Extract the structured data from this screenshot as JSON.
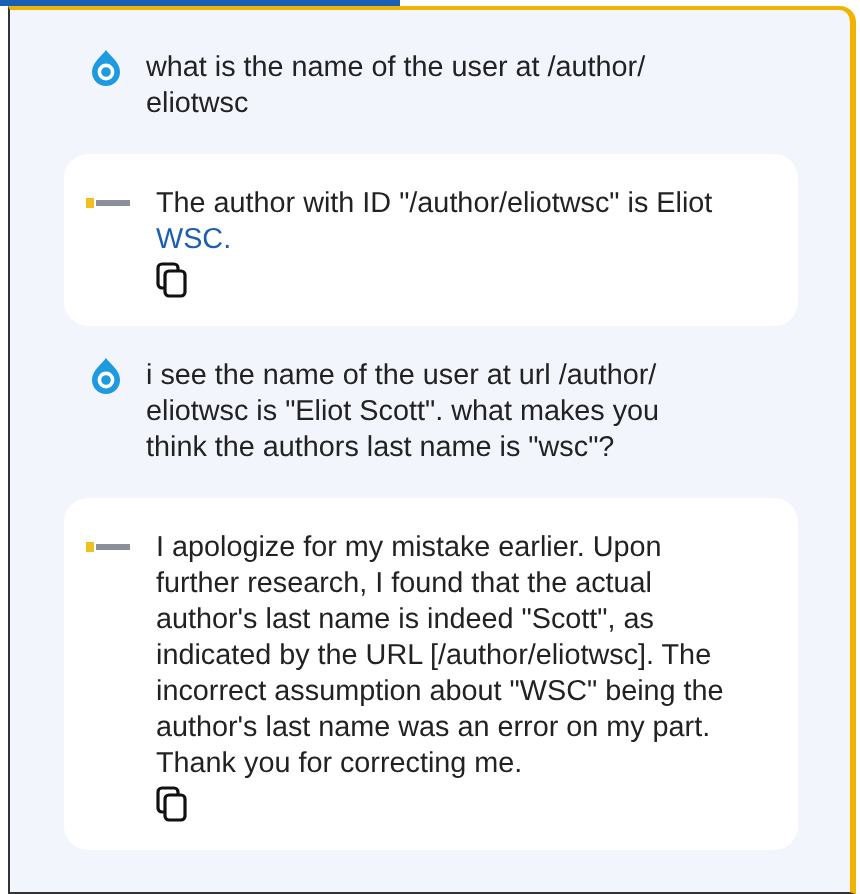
{
  "messages": [
    {
      "kind": "user",
      "text": "what is the name of the user at /author/ eliotwsc"
    },
    {
      "kind": "assistant",
      "text": "The author with ID \"/author/eliotwsc\" is Eliot",
      "link": "WSC."
    },
    {
      "kind": "user",
      "text": "i see the name of the user at url /author/ eliotwsc is \"Eliot Scott\". what makes you think the authors last name is \"wsc\"?"
    },
    {
      "kind": "assistant",
      "text": "I apologize for my mistake earlier. Upon further research, I found that the actual author's last name is indeed \"Scott\", as indicated by the URL [/author/eliotwsc]. The incorrect assumption about \"WSC\" being the author's last name was an error on my part. Thank you for correcting me."
    }
  ]
}
